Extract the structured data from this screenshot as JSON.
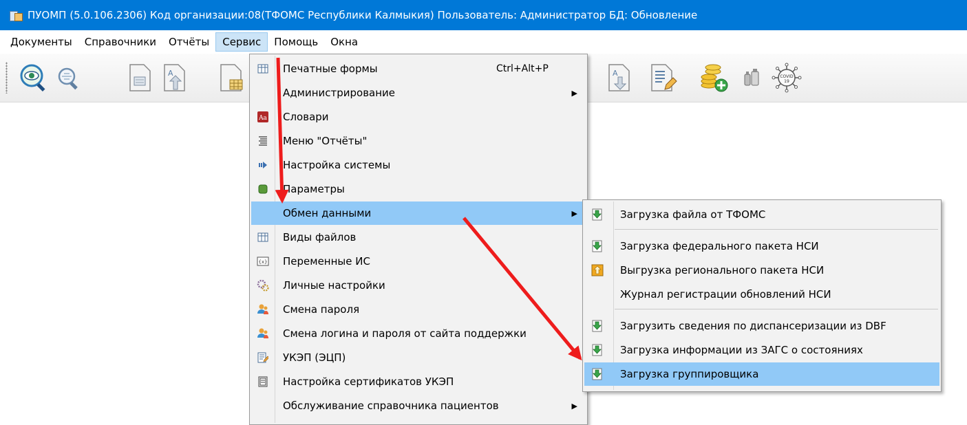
{
  "window": {
    "title": "ПУОМП (5.0.106.2306)  Код организации:08(ТФОМС Республики Калмыкия)  Пользователь: Администратор БД: Обновление"
  },
  "menubar": {
    "items": [
      {
        "label": "Документы"
      },
      {
        "label": "Справочники"
      },
      {
        "label": "Отчёты"
      },
      {
        "label": "Сервис"
      },
      {
        "label": "Помощь"
      },
      {
        "label": "Окна"
      }
    ],
    "active": "Сервис"
  },
  "toolbar": {
    "buttons": [
      {
        "icon": "eye-search-icon"
      },
      {
        "icon": "search-icon"
      },
      {
        "icon": "document-icon"
      },
      {
        "icon": "document-up-icon"
      },
      {
        "icon": "document-table-icon"
      },
      {
        "icon": "document-down-icon"
      },
      {
        "icon": "document-edit-icon"
      },
      {
        "icon": "coins-add-icon"
      },
      {
        "icon": "bottles-icon"
      },
      {
        "icon": "covid-icon"
      }
    ]
  },
  "service_menu": {
    "items": [
      {
        "label": "Печатные формы",
        "shortcut": "Ctrl+Alt+P",
        "icon": "grid-icon"
      },
      {
        "label": "Администрирование",
        "submenu": true
      },
      {
        "label": "Словари",
        "icon": "dictionary-icon"
      },
      {
        "label": "Меню \"Отчёты\"",
        "icon": "list-icon"
      },
      {
        "label": "Настройка системы",
        "icon": "settings-icon"
      },
      {
        "label": "Параметры",
        "icon": "database-icon"
      },
      {
        "label": "Обмен данными",
        "submenu": true,
        "highlighted": true
      },
      {
        "label": "Виды файлов",
        "icon": "grid-icon"
      },
      {
        "label": "Переменные ИС",
        "icon": "variable-icon"
      },
      {
        "label": "Личные настройки",
        "icon": "gears-icon"
      },
      {
        "label": "Смена пароля",
        "icon": "users-icon"
      },
      {
        "label": "Смена логина и пароля от сайта поддержки",
        "icon": "users-icon"
      },
      {
        "label": "УКЭП (ЭЦП)",
        "icon": "signature-icon"
      },
      {
        "label": "Настройка сертификатов УКЭП",
        "icon": "certificate-icon"
      },
      {
        "label": "Обслуживание справочника пациентов",
        "submenu": true
      }
    ]
  },
  "exchange_submenu": {
    "items": [
      {
        "label": "Загрузка файла от ТФОМС",
        "icon": "download-icon"
      },
      {
        "label": "Загрузка федерального пакета НСИ",
        "icon": "download-icon"
      },
      {
        "label": "Выгрузка регионального пакета НСИ",
        "icon": "upload-icon"
      },
      {
        "label": "Журнал регистрации обновлений НСИ"
      },
      {
        "label": "Загрузить сведения по диспансеризации из DBF",
        "icon": "download-icon"
      },
      {
        "label": "Загрузка информации из ЗАГС о состояниях",
        "icon": "download-icon"
      },
      {
        "label": "Загрузка группировщика",
        "icon": "download-icon",
        "highlighted": true
      }
    ]
  },
  "colors": {
    "titlebar": "#0078d7",
    "menu_highlight": "#91c9f7",
    "annotation_arrow": "#ee1c1c"
  }
}
